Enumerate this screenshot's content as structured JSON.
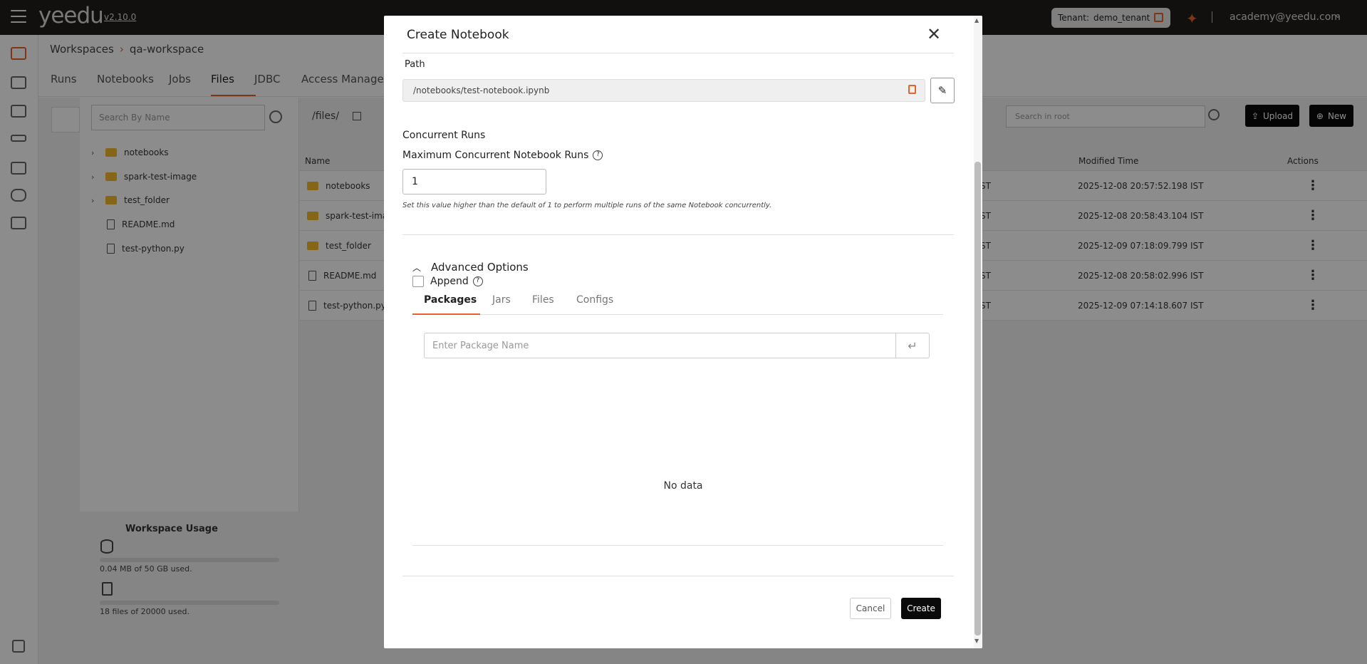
{
  "app": {
    "logo": "yeedu",
    "version": "v2.10.0",
    "tenant_label": "Tenant:",
    "tenant_name": "demo_tenant",
    "user": "academy@yeedu.com"
  },
  "breadcrumb": {
    "root": "Workspaces",
    "current": "qa-workspace"
  },
  "tabs": [
    "Runs",
    "Notebooks",
    "Jobs",
    "Files",
    "JDBC",
    "Access Manageme"
  ],
  "files": {
    "tree_search_placeholder": "Search By Name",
    "tree": [
      {
        "type": "folder",
        "name": "notebooks"
      },
      {
        "type": "folder",
        "name": "spark-test-image"
      },
      {
        "type": "folder",
        "name": "test_folder"
      },
      {
        "type": "file",
        "name": "README.md"
      },
      {
        "type": "file",
        "name": "test-python.py"
      }
    ],
    "usage_title": "Workspace Usage",
    "usage_storage": "0.04 MB of 50 GB used.",
    "usage_storage_fraction": 0.0001,
    "usage_files": "18 files of 20000 used.",
    "usage_files_fraction": 0.0009,
    "path": "/files/",
    "root_search_placeholder": "Search in root",
    "upload_label": "Upload",
    "new_label": "New",
    "columns": {
      "name": "Name",
      "modified": "Modified Time",
      "actions": "Actions"
    },
    "rows": [
      {
        "type": "folder",
        "name": "notebooks",
        "tz": "ST",
        "modified": "2025-12-08 20:57:52.198 IST"
      },
      {
        "type": "folder",
        "name": "spark-test-ima",
        "tz": "ST",
        "modified": "2025-12-08 20:58:43.104 IST"
      },
      {
        "type": "folder",
        "name": "test_folder",
        "tz": "ST",
        "modified": "2025-12-09 07:18:09.799 IST"
      },
      {
        "type": "file",
        "name": "README.md",
        "tz": "ST",
        "modified": "2025-12-08 20:58:02.996 IST"
      },
      {
        "type": "file",
        "name": "test-python.py",
        "tz": "ST",
        "modified": "2025-12-09 07:14:18.607 IST"
      }
    ]
  },
  "modal": {
    "title": "Create Notebook",
    "path_label": "Path",
    "path_value": "/notebooks/test-notebook.ipynb",
    "concurrent_heading": "Concurrent Runs",
    "max_runs_label": "Maximum Concurrent Notebook Runs",
    "max_runs_value": "1",
    "hint": "Set this value higher than the default of 1 to perform multiple runs of the same Notebook concurrently.",
    "advanced_label": "Advanced Options",
    "append_label": "Append",
    "tabs": [
      "Packages",
      "Jars",
      "Files",
      "Configs"
    ],
    "package_placeholder": "Enter Package Name",
    "no_data": "No data",
    "cancel_label": "Cancel",
    "create_label": "Create"
  },
  "colors": {
    "accent": "#e8622a",
    "topbar": "#221c1c",
    "folder": "#f2bb2a"
  }
}
